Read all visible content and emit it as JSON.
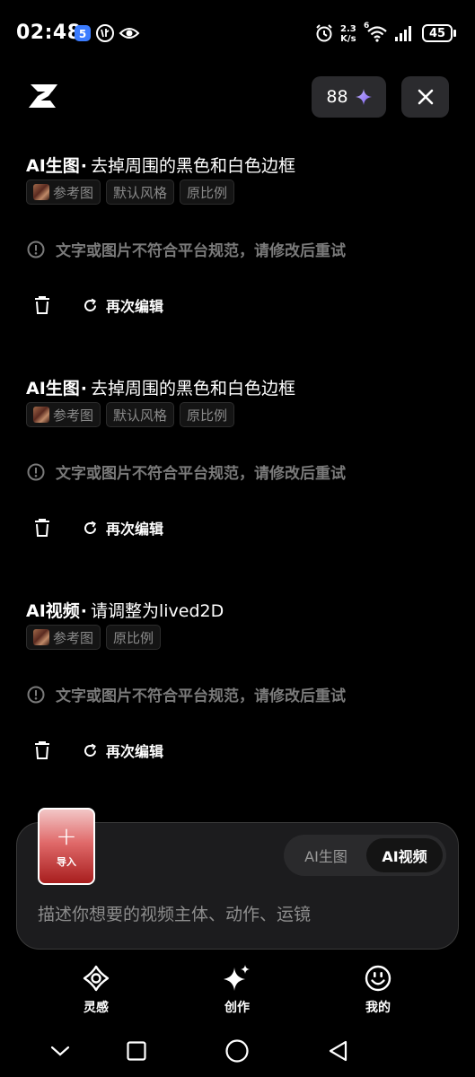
{
  "status": {
    "time": "02:48",
    "net_speed_top": "2.3",
    "net_speed_bottom": "K/s",
    "wifi_gen": "6",
    "battery": "45"
  },
  "header": {
    "credits": "88",
    "logo_icon": "z-logo-icon",
    "close_icon": "close-icon"
  },
  "tasks": [
    {
      "type": "AI生图",
      "prompt": "去掉周围的黑色和白色边框",
      "chips": [
        "参考图",
        "默认风格",
        "原比例"
      ],
      "error": "文字或图片不符合平台规范，请修改后重试",
      "edit_label": "再次编辑"
    },
    {
      "type": "AI生图",
      "prompt": "去掉周围的黑色和白色边框",
      "chips": [
        "参考图",
        "默认风格",
        "原比例"
      ],
      "error": "文字或图片不符合平台规范，请修改后重试",
      "edit_label": "再次编辑"
    },
    {
      "type": "AI视频",
      "prompt": "请调整为lived2D",
      "chips": [
        "参考图",
        "原比例"
      ],
      "error": "文字或图片不符合平台规范，请修改后重试",
      "edit_label": "再次编辑"
    }
  ],
  "composer": {
    "import_label": "导入",
    "mode_image": "AI生图",
    "mode_video": "AI视频",
    "selected_mode": "AI视频",
    "placeholder": "描述你想要的视频主体、动作、运镜"
  },
  "nav": {
    "inspiration": "灵感",
    "create": "创作",
    "mine": "我的"
  },
  "colors": {
    "background": "#000000",
    "surface": "#1c1c1e",
    "muted_text": "#7a7a7a",
    "accent_sparkle": "#8b7cf6"
  }
}
